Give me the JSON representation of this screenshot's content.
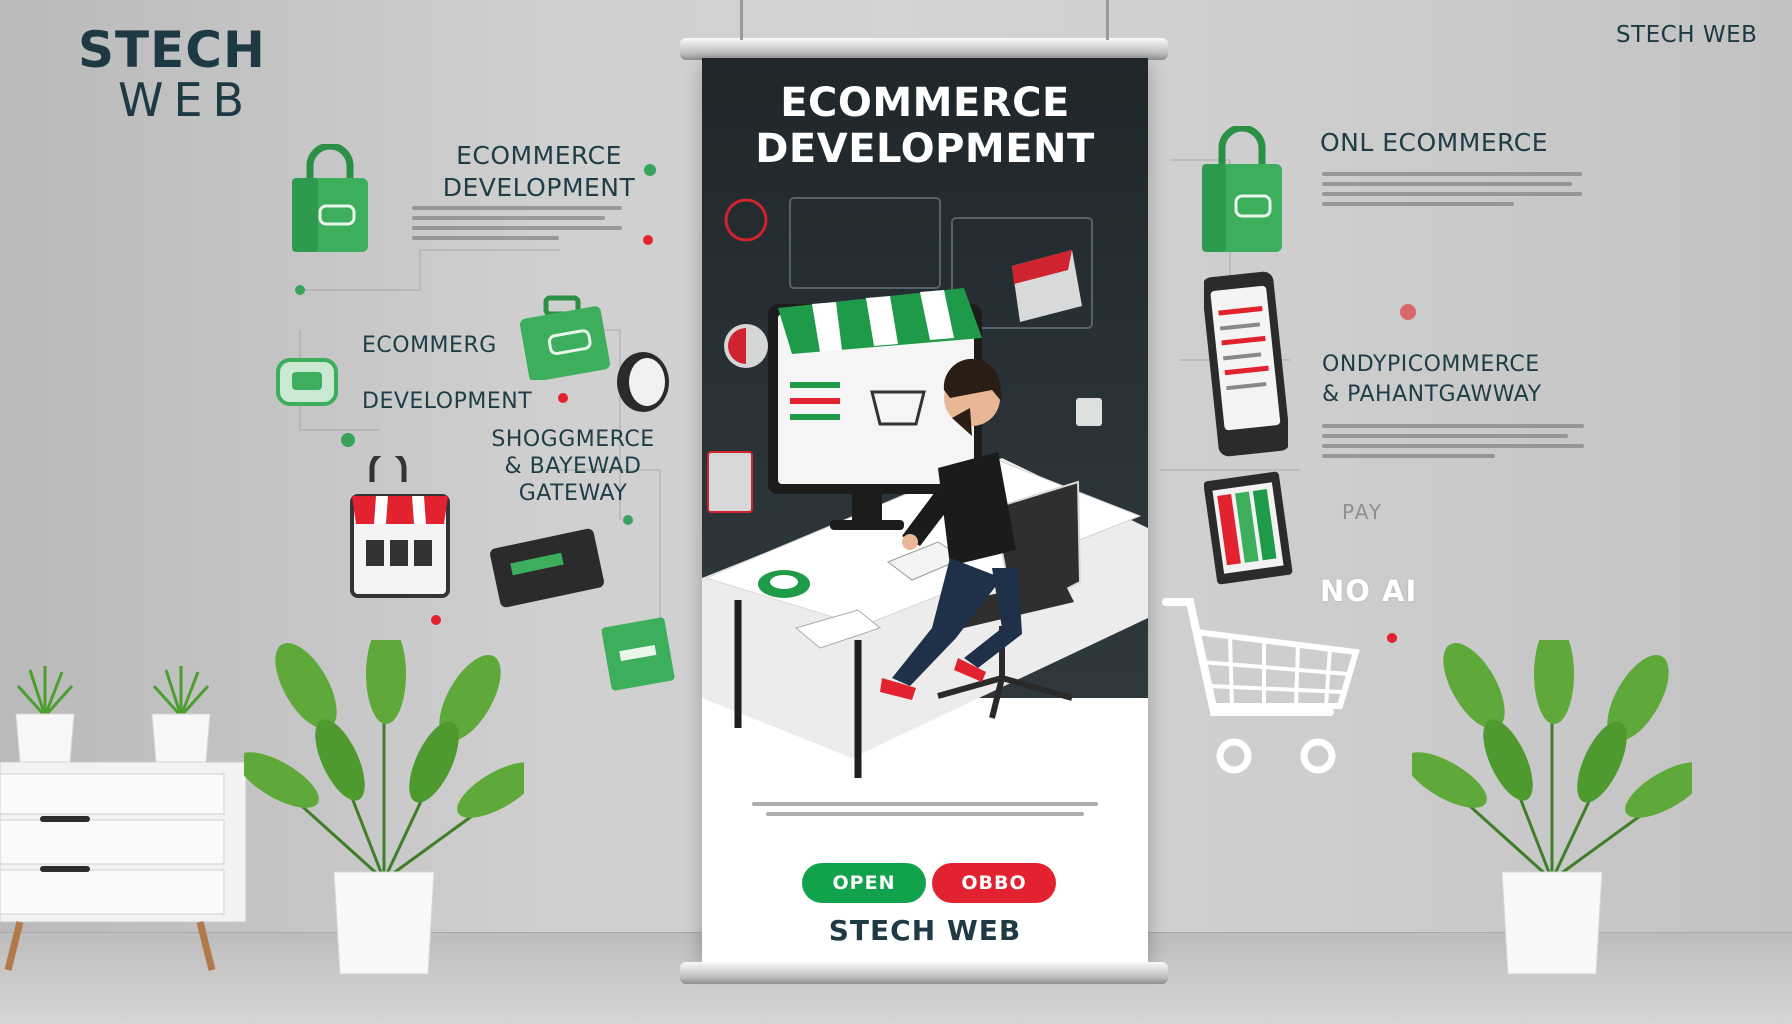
{
  "brand": {
    "top_left_line1": "STECH",
    "top_left_line2": "WEB",
    "top_right": "STECH WEB"
  },
  "left_panel": {
    "heading1_line1": "ECOMMERCE",
    "heading1_line2": "DEVELOPMENT",
    "heading2_line1": "ECOMMERG",
    "heading2_line2": "DEVELOPMENT",
    "heading3_line1": "SHOGGMERCE",
    "heading3_line2": "& BAYEWAD",
    "heading3_line3": "GATEWAY"
  },
  "right_panel": {
    "heading1": "ONL ECOMMERCE",
    "heading2_line1": "ONDYPICOMMERCE",
    "heading2_line2": "& PAHANTGAWWAY",
    "pay_label": "PAY",
    "no_ai": "NO AI"
  },
  "banner": {
    "title_line1": "ECOMMERCE",
    "title_line2": "DEVELOPMENT",
    "open_button": "OPEN",
    "red_button": "OBBO",
    "footer": "STECH WEB"
  },
  "colors": {
    "accent_green": "#12a24b",
    "accent_red": "#e2222f",
    "banner_dark": "#232c30",
    "text_dark": "#1e3d47"
  },
  "icons": [
    "shopping-bag-icon",
    "storefront-icon",
    "shopping-cart-icon",
    "tablet-icon",
    "plant-icon",
    "cabinet-icon"
  ]
}
